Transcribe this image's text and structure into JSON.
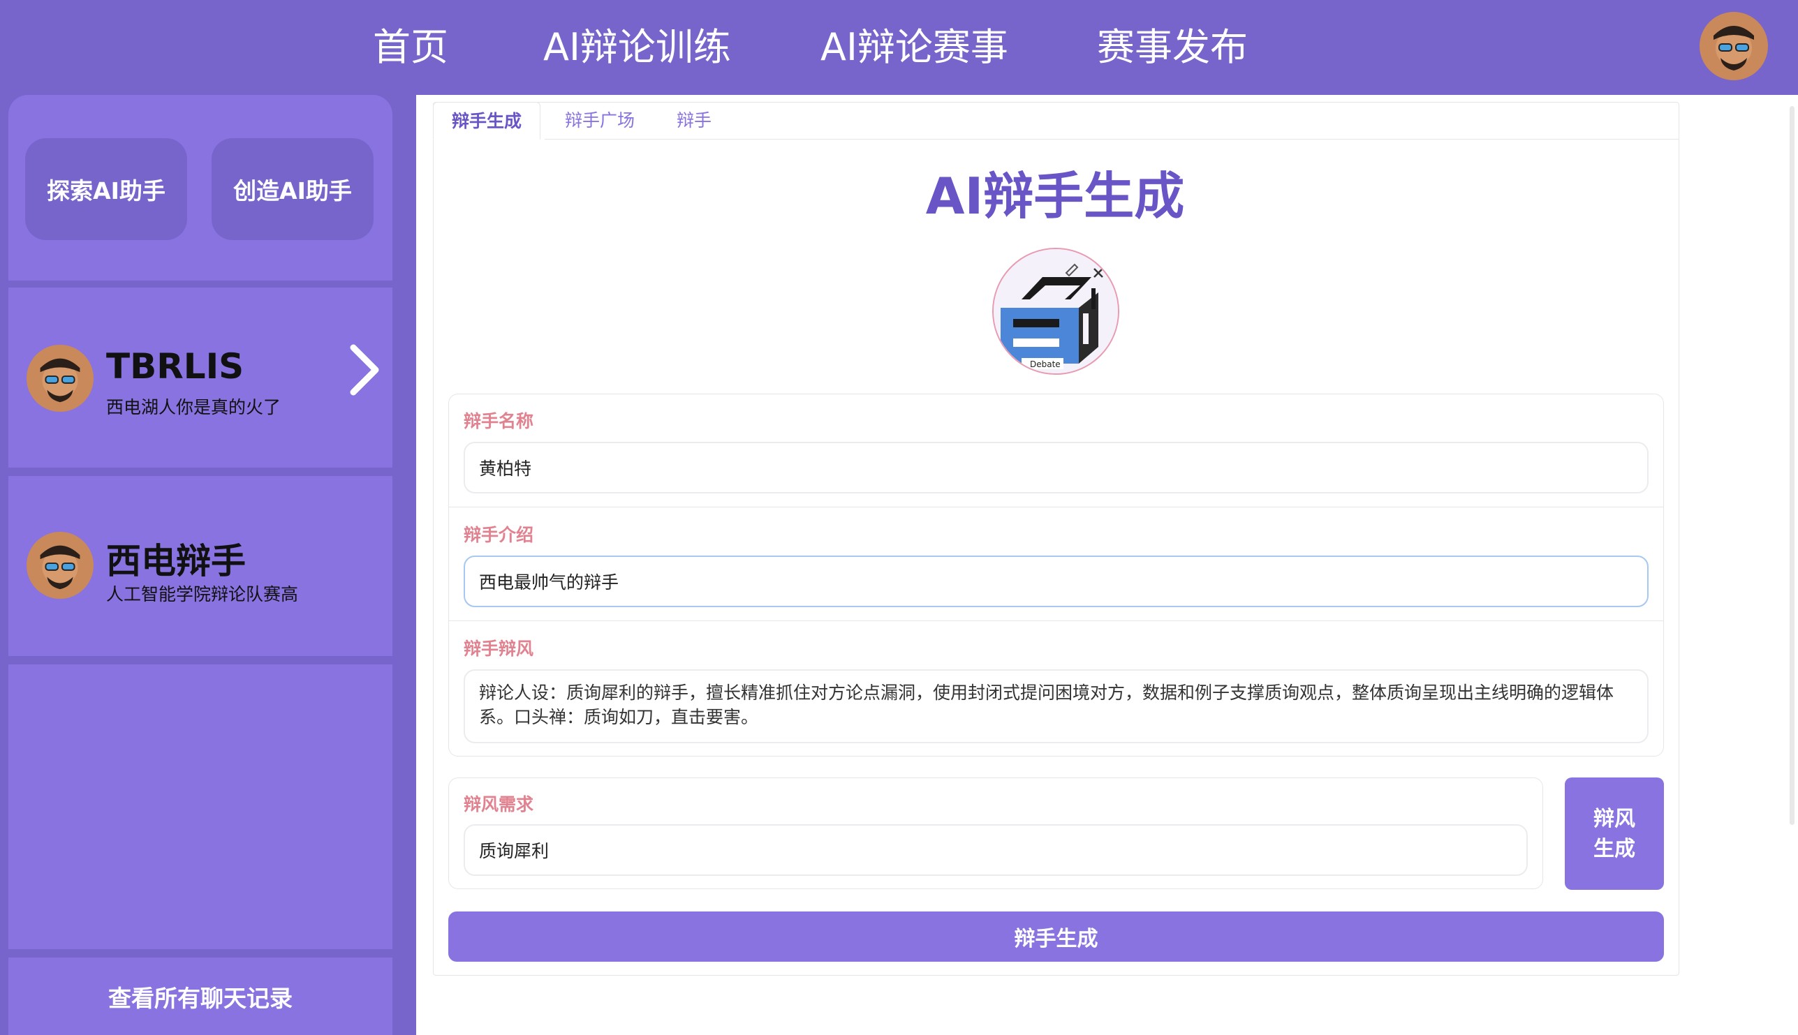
{
  "nav": {
    "items": [
      "首页",
      "AI辩论训练",
      "AI辩论赛事",
      "赛事发布"
    ]
  },
  "sidebar": {
    "explore_button": "探索AI助手",
    "create_button": "创造AI助手",
    "chats": [
      {
        "name": "TBRLIS",
        "subtitle": "西电湖人你是真的火了"
      },
      {
        "name": "西电辩手",
        "subtitle": "人工智能学院辩论队赛高"
      }
    ],
    "view_all": "查看所有聊天记录"
  },
  "tabs": [
    "辩手生成",
    "辩手广场",
    "辩手"
  ],
  "main": {
    "title": "AI辩手生成",
    "logo_caption": "Debate",
    "fields": {
      "name_label": "辩手名称",
      "name_value": "黄柏特",
      "intro_label": "辩手介绍",
      "intro_value": "西电最帅气的辩手",
      "style_label": "辩手辩风",
      "style_value": "辩论人设：质询犀利的辩手，擅长精准抓住对方论点漏洞，使用封闭式提问困境对方，数据和例子支撑质询观点，整体质询呈现出主线明确的逻辑体系。口头禅：质询如刀，直击要害。",
      "demand_label": "辩风需求",
      "demand_value": "质询犀利"
    },
    "style_gen_button": "辩风生成",
    "generate_button": "辩手生成"
  },
  "colors": {
    "header": "#7765cb",
    "sidebar_block": "#8873e0",
    "accent": "#6a55c7",
    "label": "#e0828f",
    "focus_border": "#a6c8f3"
  }
}
